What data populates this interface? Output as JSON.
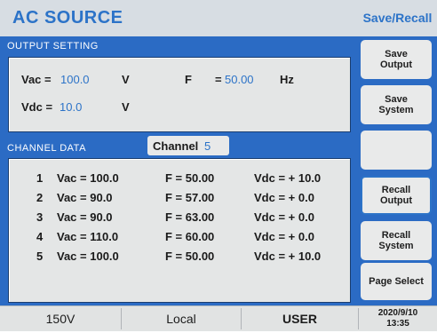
{
  "app": {
    "title": "AC SOURCE",
    "top_right": "Save/Recall"
  },
  "output_setting": {
    "label": "OUTPUT SETTING",
    "vac_label": "Vac =",
    "vac_value": "100.0",
    "vac_unit": "V",
    "f_label": "F",
    "f_eq": "=",
    "f_value": "50.00",
    "f_unit": "Hz",
    "vdc_label": "Vdc =",
    "vdc_value": "10.0",
    "vdc_unit": "V"
  },
  "channel_data": {
    "label": "CHANNEL DATA",
    "channel_label": "Channel",
    "channel_value": "5",
    "rows": [
      {
        "num": "1",
        "vac": "Vac = 100.0",
        "f": "F = 50.00",
        "vdc": "Vdc = + 10.0"
      },
      {
        "num": "2",
        "vac": "Vac = 90.0",
        "f": "F = 57.00",
        "vdc": "Vdc = + 0.0"
      },
      {
        "num": "3",
        "vac": "Vac = 90.0",
        "f": "F = 63.00",
        "vdc": "Vdc = + 0.0"
      },
      {
        "num": "4",
        "vac": "Vac = 110.0",
        "f": "F = 60.00",
        "vdc": "Vdc = + 0.0"
      },
      {
        "num": "5",
        "vac": "Vac = 100.0",
        "f": "F = 50.00",
        "vdc": "Vdc = + 10.0"
      }
    ]
  },
  "softkeys": {
    "save_output": "Save\nOutput",
    "save_system": "Save\nSystem",
    "empty": "",
    "recall_output": "Recall\nOutput",
    "recall_system": "Recall\nSystem",
    "page_select": "Page Select"
  },
  "status": {
    "voltage_range": "150V",
    "mode": "Local",
    "user": "USER",
    "date": "2020/9/10",
    "time": "13:35"
  }
}
